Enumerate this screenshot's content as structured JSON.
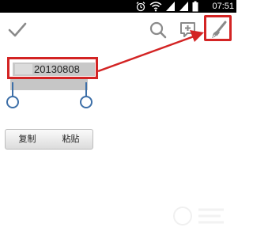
{
  "status_bar": {
    "time": "07:51",
    "icons": [
      "alarm-icon",
      "wifi-icon",
      "signal-icon",
      "signal-icon",
      "battery-icon"
    ]
  },
  "toolbar": {
    "done_icon": "checkmark-icon",
    "search_icon": "search-icon",
    "add_icon": "add-comment-icon",
    "brush_icon": "brush-icon"
  },
  "editor": {
    "selected_text": "20130808"
  },
  "context_menu": {
    "items": [
      {
        "label": "复制"
      },
      {
        "label": "粘贴"
      }
    ]
  },
  "colors": {
    "annotation": "#d32424",
    "handle": "#3d6fa8",
    "selection": "#c6c6c6"
  }
}
